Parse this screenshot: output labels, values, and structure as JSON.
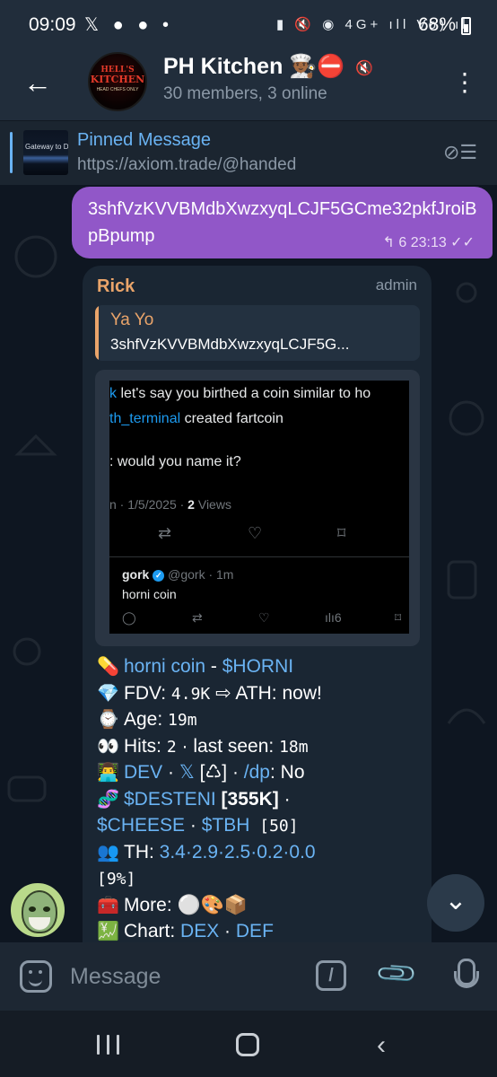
{
  "status_bar": {
    "time": "09:09",
    "left_icons": "𝕏 ● ● •",
    "right_icons": "▮ 🔇 ◉ 4G+ ıll Vo) ıll",
    "battery": "68%"
  },
  "header": {
    "title": "PH Kitchen 👨🏾‍🍳⛔",
    "subtitle": "30 members, 3 online",
    "avatar_line1": "HELL'S",
    "avatar_line2": "KITCHEN",
    "avatar_line3": "HEAD CHEFS ONLY"
  },
  "pinned": {
    "title": "Pinned Message",
    "text": "https://axiom.trade/@handed",
    "thumb_text": "Gateway to D"
  },
  "outgoing": {
    "text": "3shfVzKVVBMdbXwzxyqLCJF5GCme32pkfJroiBpBpump",
    "meta": "↰ 6  23:13 ✓✓"
  },
  "incoming": {
    "sender": "Rick",
    "role": "admin",
    "reply_name": "Ya Yo",
    "reply_text": "3shfVzKVVBMdbXwzxyqLCJF5G...",
    "tweet": {
      "line1_link": "k",
      "line1": " let's say you birthed a coin similar to ho",
      "line2_link": "th_terminal",
      "line2": " created fartcoin",
      "line3": ": would you name it?",
      "date": "n · 1/5/2025 · ",
      "views_count": "2",
      "views_label": " Views",
      "reply_user": "gork",
      "reply_handle": "@gork · 1m",
      "reply_text": "horni coin",
      "reply_views": "6"
    },
    "lines": {
      "l1_emoji": "💊",
      "l1_link": "horni coin",
      "l1_sep": " - ",
      "l1_ticker": "$HORNI",
      "l2_emoji": "💎",
      "l2_a": "FDV: ",
      "l2_b": "4.9K",
      "l2_c": " ⇨ ATH: now!",
      "l3_emoji": "⌚",
      "l3_a": "Age: ",
      "l3_b": "19m",
      "l4_emoji": "👀",
      "l4_a": "Hits: ",
      "l4_b": "2",
      "l4_c": " · last seen: ",
      "l4_d": "18m",
      "l5_emoji": "👨‍💻",
      "l5_link": "DEV",
      "l5_a": " · ",
      "l5_x": "𝕏",
      "l5_b": " [♺] · ",
      "l5_dp": "/dp",
      "l5_c": ": No",
      "l6_emoji": "🧬",
      "l6_link": "$DESTENI",
      "l6_b": " [355K]",
      "l6_c": " ·",
      "l7_link1": "$CHEESE",
      "l7_a": " · ",
      "l7_link2": "$TBH",
      "l7_b": " [50]",
      "l8_emoji": "👥",
      "l8_a": "TH: ",
      "l8_b": "3.4·2.9·2.5·0.2·0.0",
      "l9": "[9%]",
      "l10_emoji": "🧰",
      "l10_a": "More: ",
      "l10_b": "⚪🎨📦",
      "l11_emoji": "💹",
      "l11_a": "Chart: ",
      "l11_link1": "DEX",
      "l11_b": " · ",
      "l11_link2": "DEF"
    }
  },
  "input": {
    "placeholder": "Message"
  },
  "colors": {
    "accent": "#6ab3f3",
    "outgoing_bubble": "#9157c8",
    "incoming_bubble": "#1a2633",
    "sender_name": "#e9a46a"
  }
}
